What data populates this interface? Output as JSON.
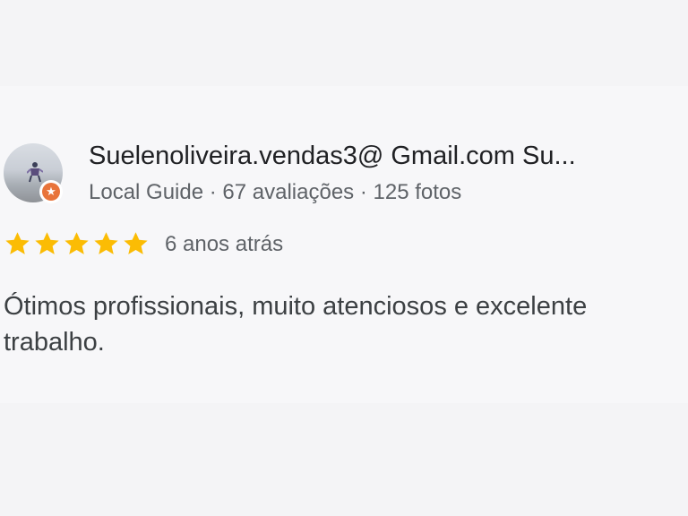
{
  "review": {
    "author_name": "Suelenoliveira.vendas3@ Gmail.com Su...",
    "author_meta": "Local Guide · 67 avaliações · 125 fotos",
    "rating": 5,
    "rating_max": 5,
    "star_color": "#fbbc04",
    "badge_color": "#e8743b",
    "badge_icon": "star-icon",
    "date": "6 anos atrás",
    "text": "Ótimos profissionais, muito atenciosos e excelente trabalho."
  }
}
